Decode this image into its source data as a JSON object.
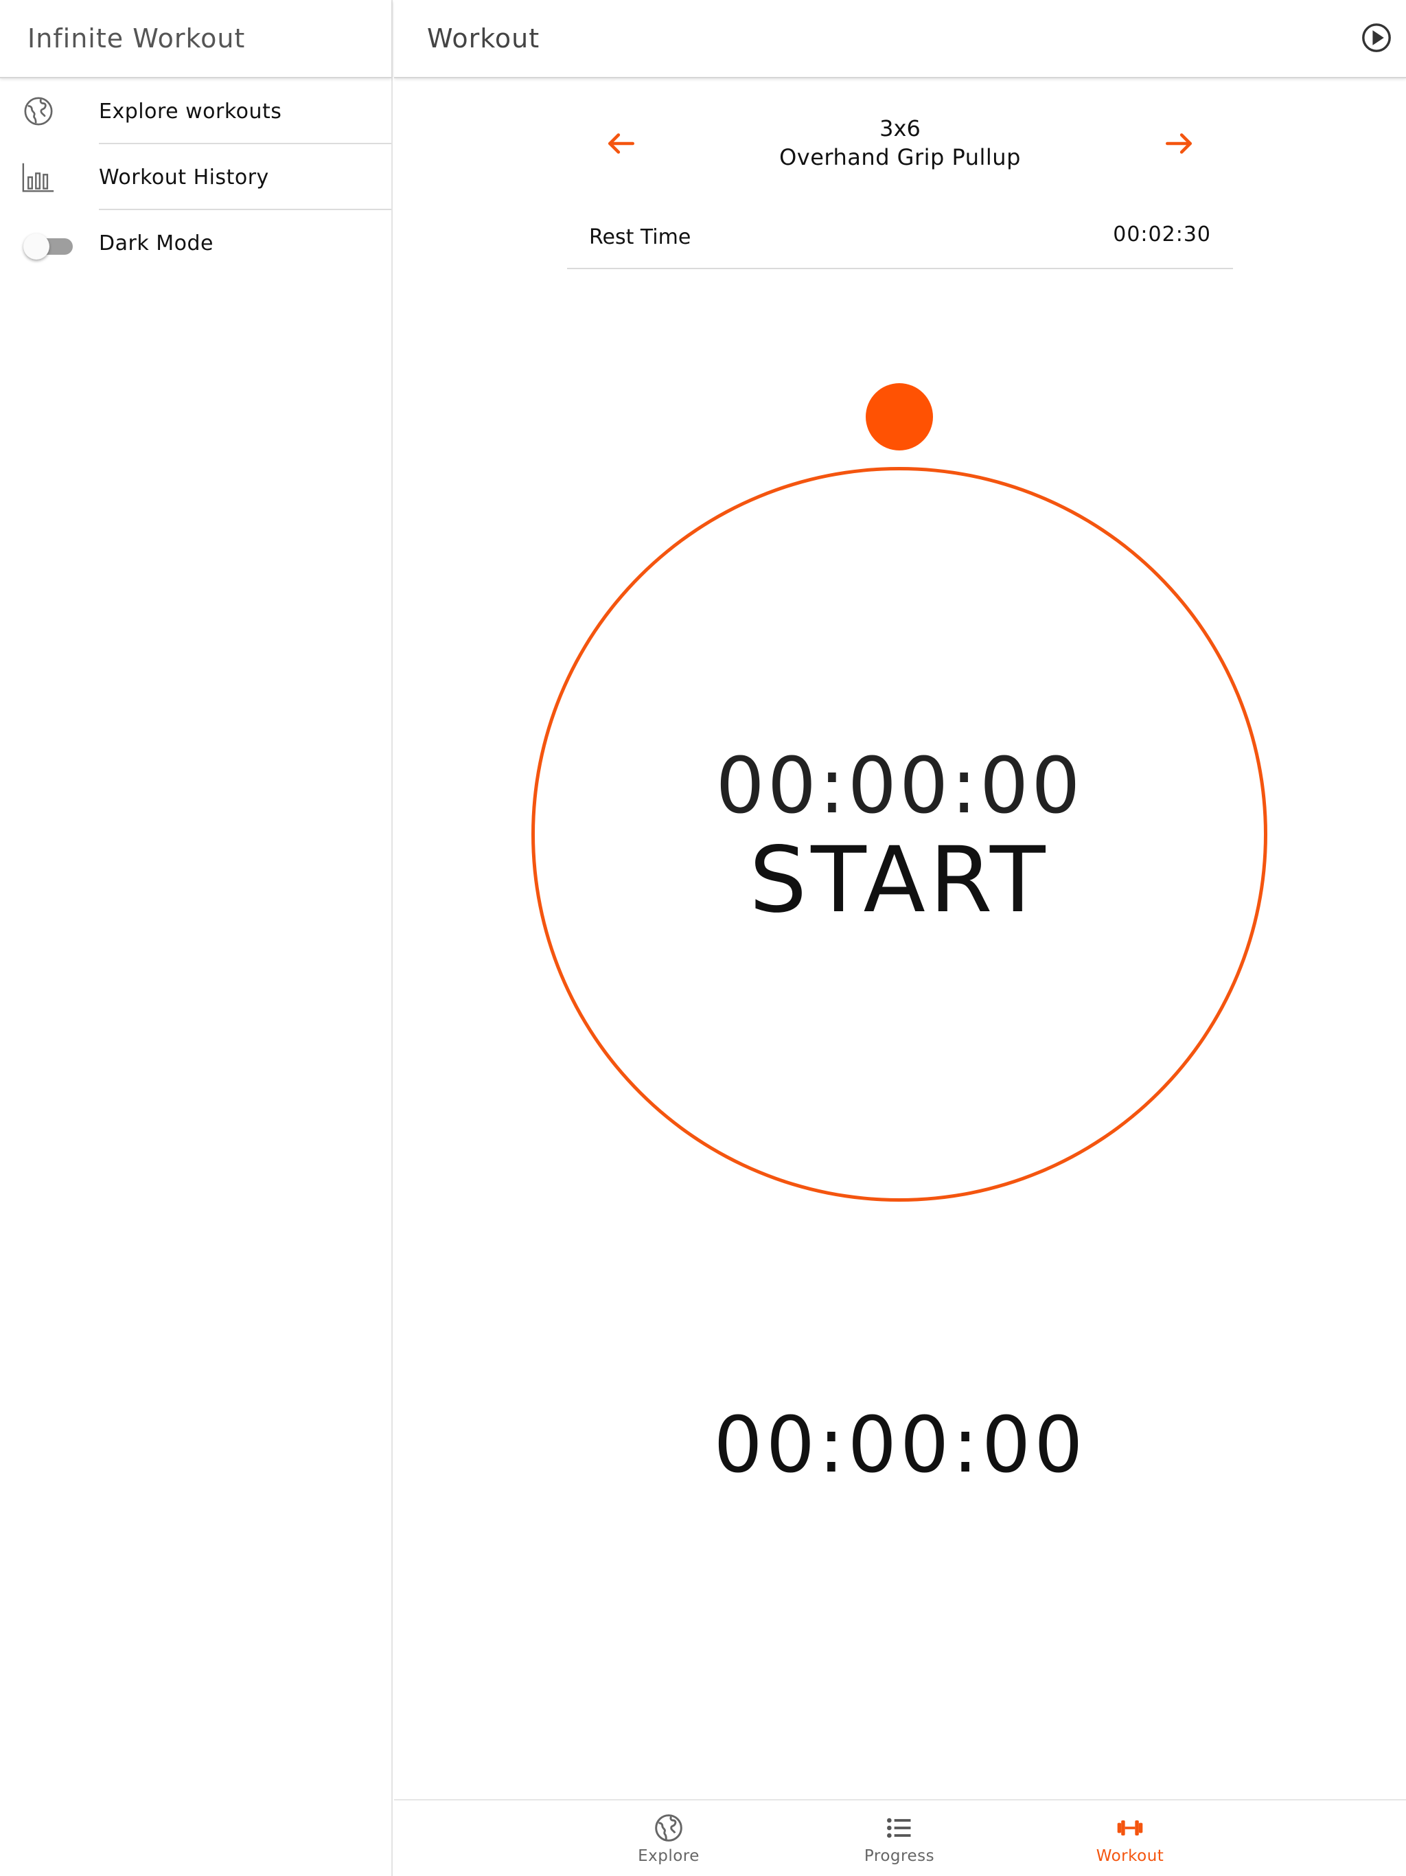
{
  "sidebar": {
    "title": "Infinite Workout",
    "items": [
      {
        "label": "Explore workouts",
        "icon": "globe-icon"
      },
      {
        "label": "Workout History",
        "icon": "bar-chart-icon"
      },
      {
        "label": "Dark Mode",
        "icon": "toggle-switch",
        "toggle_on": false
      }
    ]
  },
  "header": {
    "title": "Workout",
    "action_icon": "play-circle-icon"
  },
  "exercise": {
    "sets": "3x6",
    "name": "Overhand Grip Pullup"
  },
  "rest": {
    "label": "Rest Time",
    "value": "00:02:30"
  },
  "timer": {
    "time": "00:00:00",
    "action": "START"
  },
  "total_time": "00:00:00",
  "tabs": [
    {
      "label": "Explore",
      "icon": "globe-icon",
      "active": false
    },
    {
      "label": "Progress",
      "icon": "list-icon",
      "active": false
    },
    {
      "label": "Workout",
      "icon": "dumbbell-icon",
      "active": true
    }
  ],
  "colors": {
    "accent": "#f4550f",
    "dot": "#ff5203",
    "divider": "#dadada"
  }
}
